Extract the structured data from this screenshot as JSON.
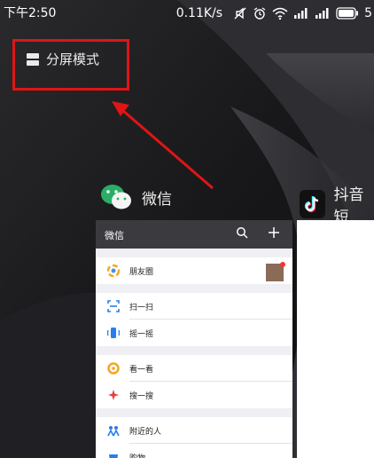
{
  "status_bar": {
    "time": "下午2:50",
    "network_speed": "0.11K/s",
    "battery_text": "5"
  },
  "split_screen": {
    "label": "分屏模式"
  },
  "apps": {
    "wechat": {
      "name": "微信"
    },
    "douyin": {
      "name": "抖音短"
    }
  },
  "wechat_card": {
    "title": "微信",
    "rows": [
      {
        "label": "朋友圈"
      },
      {
        "label": "扫一扫"
      },
      {
        "label": "摇一摇"
      },
      {
        "label": "看一看"
      },
      {
        "label": "搜一搜"
      },
      {
        "label": "附近的人"
      },
      {
        "label": "购物"
      }
    ]
  },
  "colors": {
    "highlight_red": "#e01515",
    "wechat_green": "#2aae67"
  }
}
